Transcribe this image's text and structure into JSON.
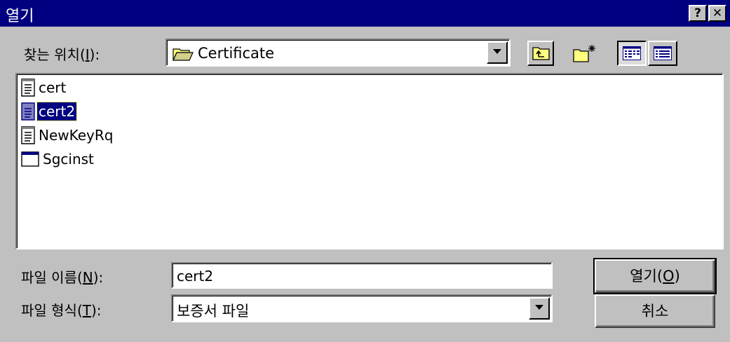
{
  "window": {
    "title": "열기",
    "help_label": "?",
    "close_label": "✕"
  },
  "look_in": {
    "label_prefix": "찾는 위치(",
    "label_key": "I",
    "label_suffix": "):",
    "value": "Certificate"
  },
  "toolbar": {
    "up_folder_icon": "folder-up-icon",
    "new_folder_icon": "new-folder-icon",
    "list_view_icon": "list-view-icon",
    "details_view_icon": "details-view-icon"
  },
  "files": [
    {
      "name": "cert",
      "icon": "text-file-icon",
      "selected": false
    },
    {
      "name": "cert2",
      "icon": "text-file-icon",
      "selected": true
    },
    {
      "name": "NewKeyRq",
      "icon": "text-file-icon",
      "selected": false
    },
    {
      "name": "Sgcinst",
      "icon": "application-icon",
      "selected": false
    }
  ],
  "filename": {
    "label_prefix": "파일 이름(",
    "label_key": "N",
    "label_suffix": "):",
    "value": "cert2"
  },
  "filetype": {
    "label_prefix": "파일 형식(",
    "label_key": "T",
    "label_suffix": "):",
    "value": "보증서 파일"
  },
  "buttons": {
    "open_prefix": "열기(",
    "open_key": "O",
    "open_suffix": ")",
    "cancel": "취소"
  },
  "colors": {
    "title_bar": "#000080",
    "face": "#c0c0c0",
    "selection": "#000080"
  }
}
